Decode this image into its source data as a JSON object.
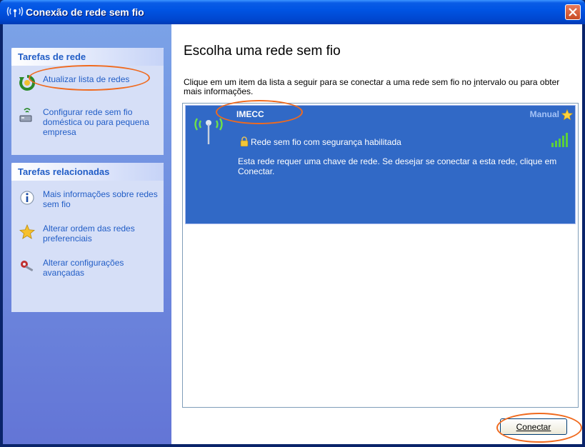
{
  "window": {
    "title": "Conexão de rede sem fio",
    "title_icon_label": "((ı))"
  },
  "sidebar": {
    "network_tasks": {
      "header": "Tarefas de rede",
      "items": [
        {
          "label": "Atualizar lista de redes",
          "icon": "refresh-icon"
        },
        {
          "label": "Configurar rede sem fio doméstica ou para pequena empresa",
          "icon": "network-setup-icon"
        }
      ]
    },
    "related_tasks": {
      "header": "Tarefas relacionadas",
      "items": [
        {
          "label": "Mais informações sobre redes sem fio",
          "icon": "info-icon"
        },
        {
          "label": "Alterar ordem das redes preferenciais",
          "icon": "star-icon"
        },
        {
          "label": "Alterar configurações avançadas",
          "icon": "settings-icon"
        }
      ]
    }
  },
  "main": {
    "title": "Escolha uma rede sem fio",
    "instructions_before": "Clique em um item da lista a seguir para se conectar a uma rede sem fio no ",
    "instructions_underlined": "i",
    "instructions_after": "ntervalo ou para obter mais informações."
  },
  "networks": [
    {
      "name": "IMECC",
      "type": "Manual",
      "security": "Rede sem fio com segurança habilitada",
      "description": "Esta rede requer uma chave de rede. Se desejar se conectar a esta rede, clique em Conectar.",
      "signal_bars": 5,
      "selected": true
    }
  ],
  "buttons": {
    "connect": "Conectar"
  },
  "colors": {
    "titlebar": "#0054e3",
    "selected_item": "#3169c6",
    "task_link": "#215dc6",
    "annotation": "#f06a1e"
  }
}
